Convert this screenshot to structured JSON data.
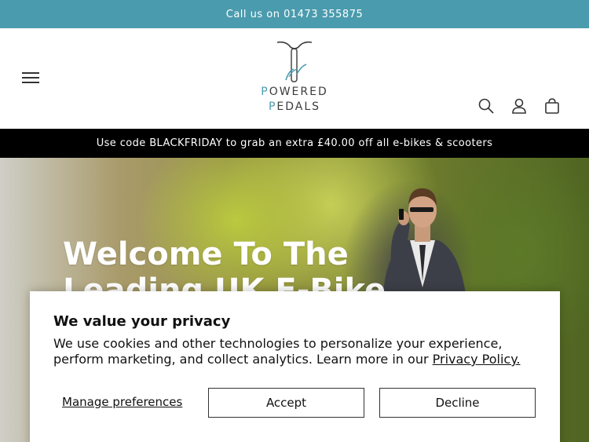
{
  "topbar": {
    "text": "Call us on 01473 355875"
  },
  "header": {
    "logo_line1_first": "P",
    "logo_line1_rest": "OWERED",
    "logo_line2_first": "P",
    "logo_line2_rest": "EDALS",
    "icons": [
      "menu-icon",
      "search-icon",
      "account-icon",
      "cart-icon"
    ]
  },
  "promo": {
    "text": "Use code BLACKFRIDAY to grab an extra £40.00 off all e-bikes & scooters"
  },
  "hero": {
    "title": "Welcome To The Leading UK E-Bike"
  },
  "cookie": {
    "title": "We value your privacy",
    "body": "We use cookies and other technologies to personalize your experience, perform marketing, and collect analytics. Learn more in our ",
    "link": "Privacy Policy.",
    "manage": "Manage preferences",
    "accept": "Accept",
    "decline": "Decline"
  },
  "colors": {
    "brand": "#4a9bad",
    "promo_bg": "#000000"
  }
}
